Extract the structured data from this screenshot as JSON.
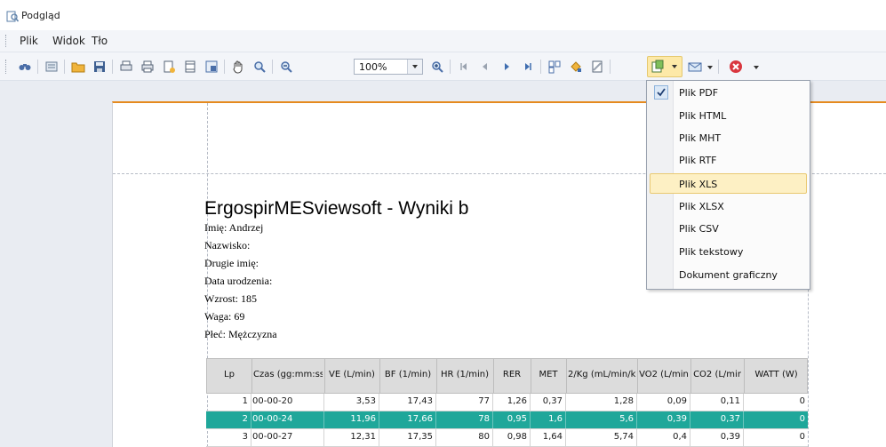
{
  "window": {
    "title": "Podgląd"
  },
  "menu": {
    "items": [
      "Plik",
      "Widok",
      "Tło"
    ]
  },
  "toolbar": {
    "zoom_value": "100%"
  },
  "report": {
    "title": "ErgospirMESviewsoft  -  Wyniki b",
    "fields": [
      "Imię: Andrzej",
      "Nazwisko:",
      "Drugie imię:",
      "Data urodzenia:",
      "Wzrost: 185",
      "Waga: 69",
      "Płeć: Mężczyzna"
    ]
  },
  "table": {
    "columns": [
      "Lp",
      "Czas (gg:mm:ss",
      "VE (L/min)",
      "BF (1/min)",
      "HR (1/min)",
      "RER",
      "MET",
      "2/Kg (mL/min/k",
      "VO2 (L/min",
      "CO2 (L/mir",
      "WATT (W)"
    ],
    "rows": [
      [
        "1",
        "00-00-20",
        "3,53",
        "17,43",
        "77",
        "1,26",
        "0,37",
        "1,28",
        "0,09",
        "0,11",
        "0"
      ],
      [
        "2",
        "00-00-24",
        "11,96",
        "17,66",
        "78",
        "0,95",
        "1,6",
        "5,6",
        "0,39",
        "0,37",
        "0"
      ],
      [
        "3",
        "00-00-27",
        "12,31",
        "17,35",
        "80",
        "0,98",
        "1,64",
        "5,74",
        "0,4",
        "0,39",
        "0"
      ]
    ],
    "highlight_color": "#1fa79a"
  },
  "export_menu": {
    "items": [
      "Plik PDF",
      "Plik HTML",
      "Plik MHT",
      "Plik RTF",
      "Plik XLS",
      "Plik XLSX",
      "Plik CSV",
      "Plik tekstowy",
      "Dokument graficzny"
    ]
  },
  "colors": {
    "accent_orange": "#e58a1f",
    "menu_hover": "#fdf0c4"
  }
}
